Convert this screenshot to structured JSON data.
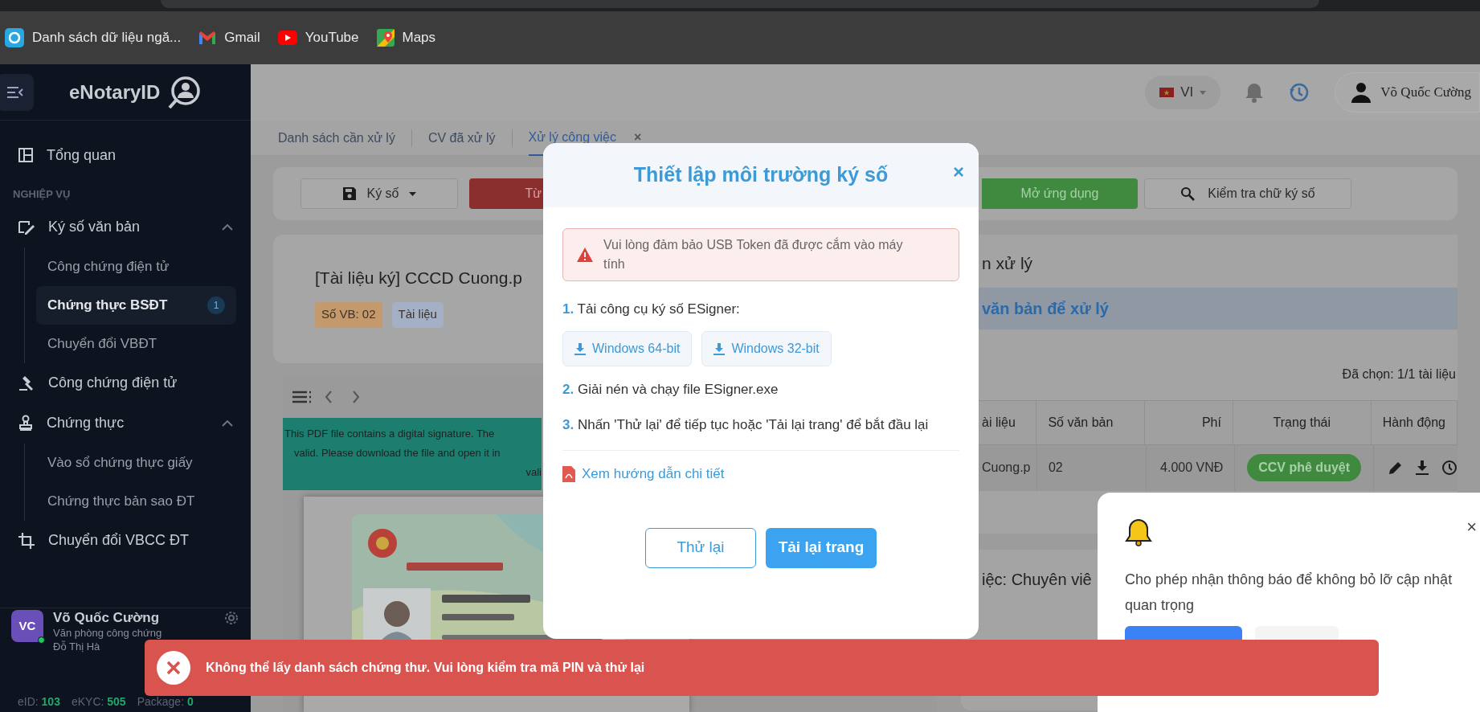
{
  "bookmarks": [
    {
      "label": "Danh sách dữ liệu ngă..."
    },
    {
      "label": "Gmail"
    },
    {
      "label": "YouTube"
    },
    {
      "label": "Maps"
    }
  ],
  "sidebar": {
    "brand": "eNotaryID",
    "items": [
      {
        "kind": "link",
        "label": "Tổng quan",
        "selected": false
      },
      {
        "kind": "section",
        "label": "NGHIỆP VỤ"
      },
      {
        "kind": "group",
        "label": "Ký số văn bản",
        "expanded": true,
        "children": [
          {
            "label": "Công chứng điện tử",
            "selected": false
          },
          {
            "label": "Chứng thực BSĐT",
            "selected": true,
            "badge": "1"
          },
          {
            "label": "Chuyển đổi VBĐT",
            "selected": false
          }
        ]
      },
      {
        "kind": "link",
        "label": "Công chứng điện tử",
        "selected": false
      },
      {
        "kind": "group",
        "label": "Chứng thực",
        "expanded": true,
        "children": [
          {
            "label": "Vào sổ chứng thực giấy",
            "selected": false
          },
          {
            "label": "Chứng thực bản sao ĐT",
            "selected": false
          }
        ]
      },
      {
        "kind": "link",
        "label": "Chuyển đổi VBCC ĐT",
        "selected": false
      }
    ],
    "user": {
      "initials": "VC",
      "name": "Võ Quốc Cường",
      "office": [
        "Văn phòng công chứng",
        "Đỗ Thị Hà"
      ],
      "online": true
    },
    "stats": [
      {
        "label": "eID:",
        "value": "103"
      },
      {
        "label": "eKYC:",
        "value": "505"
      },
      {
        "label": "Package:",
        "value": "0"
      }
    ]
  },
  "header": {
    "language": "VI",
    "user_name": "Võ Quốc Cường"
  },
  "tabs": [
    {
      "label": "Danh sách cần xử lý",
      "selected": false
    },
    {
      "label": "CV đã xử lý",
      "selected": false
    },
    {
      "label": "Xử lý công việc",
      "selected": true,
      "close": "×"
    }
  ],
  "toolbar": {
    "sign": "Ký số",
    "red_button": "Từ",
    "open_app": "Mở ứng dụng",
    "verify": "Kiểm tra chữ ký số"
  },
  "document": {
    "title": "[Tài liệu ký] CCCD Cuong.p",
    "tags": [
      {
        "label": "Số VB: 02",
        "color": "#c49a6c"
      },
      {
        "label": "Tài liệu",
        "color": "#a3b0c6"
      }
    ],
    "banner_lines": [
      "This PDF file contains a digital signature. The",
      "valid. Please download the file and open it in",
      "vali"
    ]
  },
  "right_panel": {
    "title": "n xử lý",
    "band": "văn bản để xử lý",
    "selected_count": "Đã chọn: 1/1 tài liệu",
    "columns": [
      "ài liệu",
      "Số văn bản",
      "Phí",
      "Trạng thái",
      "Hành động"
    ],
    "rows": [
      {
        "cells": [
          "Cuong.p",
          "02",
          "4.000 VNĐ"
        ],
        "status": "CCV phê duyệt"
      }
    ],
    "card2_title": "iệc: Chuyên viê"
  },
  "modal": {
    "title": "Thiết lập môi trường ký số",
    "close": "×",
    "alert": "Vui lòng đảm bảo USB Token đã được cắm vào máy tính",
    "steps": [
      {
        "number": "1.",
        "text": "Tải công cụ ký số ESigner:",
        "downloads": [
          "Windows 64-bit",
          "Windows 32-bit"
        ]
      },
      {
        "number": "2.",
        "text": "Giải nén và chạy file ESigner.exe"
      },
      {
        "number": "3.",
        "text": "Nhấn 'Thử lại' để tiếp tục hoặc 'Tải lại trang' để bắt đầu lại"
      }
    ],
    "guide_link": "Xem hướng dẫn chi tiết",
    "buttons": [
      {
        "label": "Thử lại",
        "kind": "outline"
      },
      {
        "label": "Tải lại trang",
        "kind": "primary"
      }
    ]
  },
  "notification": {
    "message": "Cho phép nhận thông báo để không bỏ lỡ cập nhật quan trọng",
    "close": "×"
  },
  "toast": {
    "message": "Không thể lấy danh sách chứng thư. Vui lòng kiểm tra mã PIN và thử lại"
  }
}
